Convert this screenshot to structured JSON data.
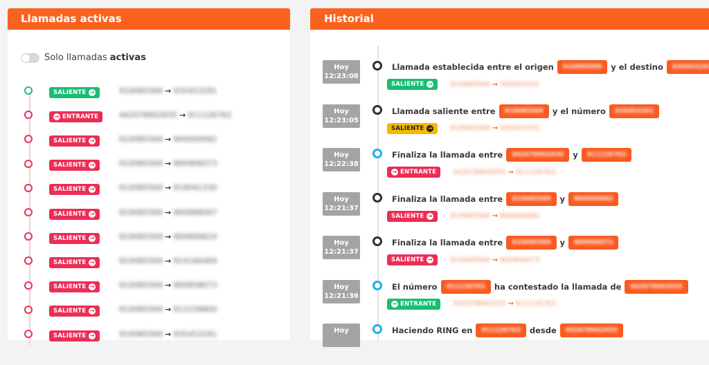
{
  "left": {
    "title": "Llamadas activas",
    "toggle": {
      "label_prefix": "Solo llamadas",
      "label_bold": "activas"
    },
    "calls": [
      {
        "dot": "green",
        "badge": "SALIENTE",
        "badge_color": "green",
        "from": "910085569",
        "to": "935453291"
      },
      {
        "dot": "red",
        "badge": "ENTRANTE",
        "badge_color": "red",
        "from": "442078902935",
        "to": "911126763"
      },
      {
        "dot": "red",
        "badge": "SALIENTE",
        "badge_color": "red",
        "from": "910085569",
        "to": "800000082"
      },
      {
        "dot": "red",
        "badge": "SALIENTE",
        "badge_color": "red",
        "from": "910085569",
        "to": "800906073"
      },
      {
        "dot": "red",
        "badge": "SALIENTE",
        "badge_color": "red",
        "from": "910085569",
        "to": "919041330"
      },
      {
        "dot": "red",
        "badge": "SALIENTE",
        "badge_color": "red",
        "from": "910085569",
        "to": "900988007"
      },
      {
        "dot": "red",
        "badge": "SALIENTE",
        "badge_color": "red",
        "from": "910085569",
        "to": "900800624"
      },
      {
        "dot": "red",
        "badge": "SALIENTE",
        "badge_color": "red",
        "from": "910085569",
        "to": "914166469"
      },
      {
        "dot": "red",
        "badge": "SALIENTE",
        "badge_color": "red",
        "from": "910085569",
        "to": "800858073"
      },
      {
        "dot": "red",
        "badge": "SALIENTE",
        "badge_color": "red",
        "from": "910085569",
        "to": "912158800"
      },
      {
        "dot": "red",
        "badge": "SALIENTE",
        "badge_color": "red",
        "from": "910085569",
        "to": "935453291"
      }
    ]
  },
  "right": {
    "title": "Historial",
    "items": [
      {
        "day": "Hoy",
        "time": "12:23:08",
        "dot": "dark",
        "text": [
          "Llamada establecida entre el origen",
          "#910085569",
          "y el destino",
          "#935453291"
        ],
        "badge": "SALIENTE",
        "badge_color": "green",
        "from": "910085569",
        "to": "935453291"
      },
      {
        "day": "Hoy",
        "time": "12:23:05",
        "dot": "dark",
        "text": [
          "Llamada saliente entre",
          "#910085569",
          "y el número",
          "#935453291"
        ],
        "badge": "SALIENTE",
        "badge_color": "yellow",
        "from": "910085569",
        "to": "935453291"
      },
      {
        "day": "Hoy",
        "time": "12:22:38",
        "dot": "blue",
        "text": [
          "Finaliza la llamada entre",
          "#442078902935",
          "y",
          "#911126763"
        ],
        "badge": "ENTRANTE",
        "badge_color": "red",
        "from": "442078902935",
        "to": "911126763"
      },
      {
        "day": "Hoy",
        "time": "12:21:37",
        "dot": "dark",
        "text": [
          "Finaliza la llamada entre",
          "#910085569",
          "y",
          "#800000082"
        ],
        "badge": "SALIENTE",
        "badge_color": "red",
        "from": "910085569",
        "to": "800000082"
      },
      {
        "day": "Hoy",
        "time": "12:21:37",
        "dot": "dark",
        "text": [
          "Finaliza la llamada entre",
          "#910085569",
          "y",
          "#800906073"
        ],
        "badge": "SALIENTE",
        "badge_color": "red",
        "from": "910085569",
        "to": "800906073"
      },
      {
        "day": "Hoy",
        "time": "12:21:36",
        "dot": "blue",
        "text": [
          "El número",
          "#911126763",
          "ha contestado la llamada de",
          "#442078902935"
        ],
        "badge": "ENTRANTE",
        "badge_color": "green",
        "from": "442078902935",
        "to": "911126763"
      },
      {
        "day": "Hoy",
        "time": "",
        "dot": "blue",
        "text": [
          "Haciendo RING en",
          "#911126763",
          "desde",
          "#442078902935"
        ],
        "badge": "",
        "badge_color": "",
        "from": "",
        "to": ""
      }
    ]
  }
}
